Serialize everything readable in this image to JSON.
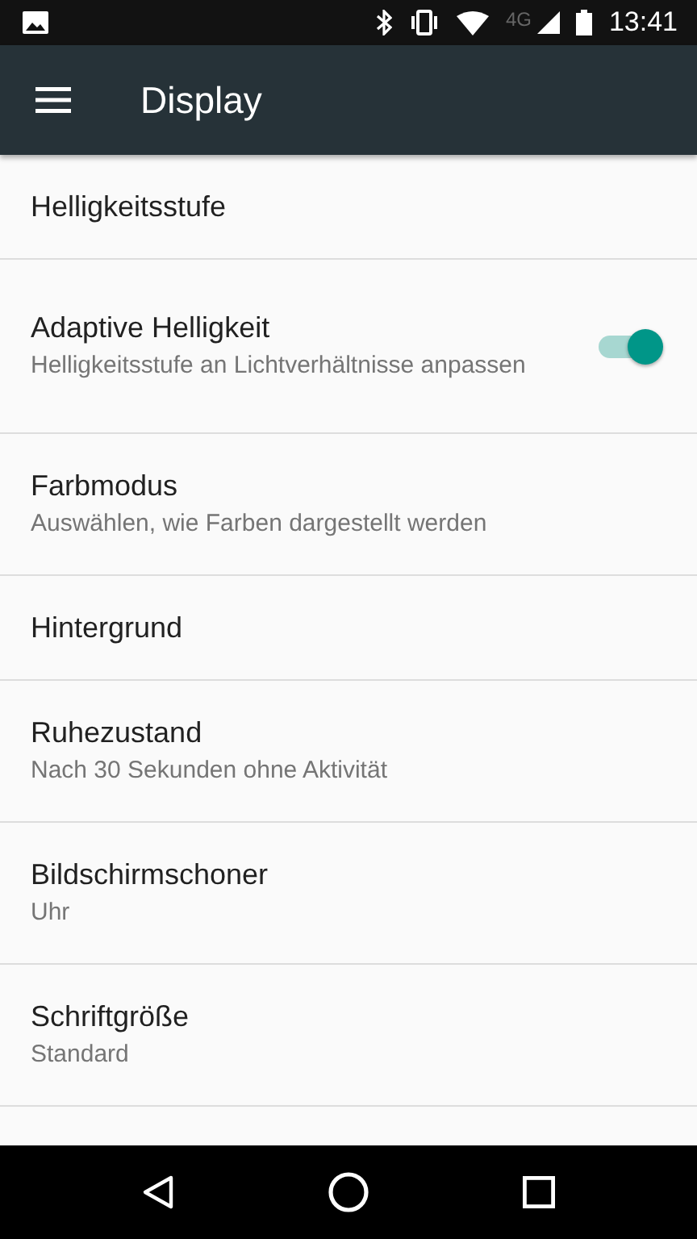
{
  "status_bar": {
    "network": "4G",
    "time": "13:41"
  },
  "app_bar": {
    "title": "Display"
  },
  "settings": [
    {
      "kind": "plain",
      "title": "Helligkeitsstufe"
    },
    {
      "kind": "switch",
      "title": "Adaptive Helligkeit",
      "summary": "Helligkeitsstufe an Lichtverhältnisse anpassen",
      "on": true
    },
    {
      "kind": "plain",
      "title": "Farbmodus",
      "summary": "Auswählen, wie Farben dargestellt werden"
    },
    {
      "kind": "plain",
      "title": "Hintergrund"
    },
    {
      "kind": "plain",
      "title": "Ruhezustand",
      "summary": "Nach 30 Sekunden ohne Aktivität"
    },
    {
      "kind": "plain",
      "title": "Bildschirmschoner",
      "summary": "Uhr"
    },
    {
      "kind": "plain",
      "title": "Schriftgröße",
      "summary": "Standard"
    }
  ]
}
